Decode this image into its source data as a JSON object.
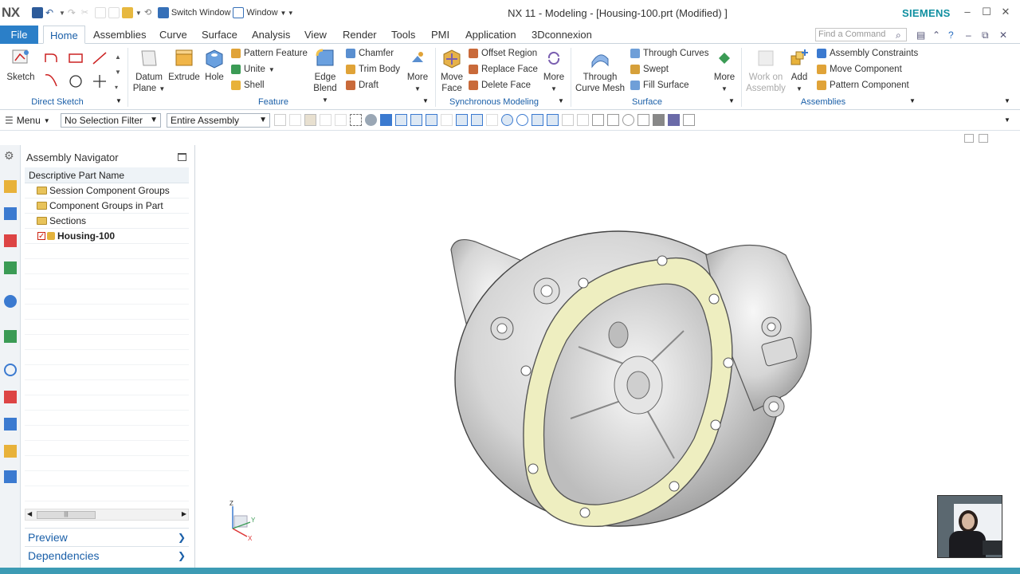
{
  "titlebar": {
    "logo": "NX",
    "switch_window": "Switch Window",
    "window_menu": "Window",
    "title": "NX 11 - Modeling - [Housing-100.prt (Modified) ]",
    "brand": "SIEMENS"
  },
  "tabs": {
    "file": "File",
    "items": [
      "Home",
      "Assemblies",
      "Curve",
      "Surface",
      "Analysis",
      "View",
      "Render",
      "Tools",
      "PMI",
      "Application",
      "3Dconnexion"
    ],
    "find_placeholder": "Find a Command"
  },
  "ribbon": {
    "direct_sketch": {
      "label": "Direct Sketch",
      "sketch": "Sketch"
    },
    "feature": {
      "label": "Feature",
      "datum_plane": [
        "Datum",
        "Plane"
      ],
      "extrude": "Extrude",
      "hole": "Hole",
      "pattern_feature": "Pattern Feature",
      "unite": "Unite",
      "shell": "Shell",
      "edge_blend": [
        "Edge",
        "Blend"
      ],
      "chamfer": "Chamfer",
      "trim_body": "Trim Body",
      "draft": "Draft",
      "more": "More"
    },
    "sync": {
      "label": "Synchronous Modeling",
      "move_face": [
        "Move",
        "Face"
      ],
      "offset_region": "Offset Region",
      "replace_face": "Replace Face",
      "delete_face": "Delete Face",
      "more": "More"
    },
    "surface": {
      "label": "Surface",
      "through_curve_mesh": [
        "Through",
        "Curve Mesh"
      ],
      "through_curves": "Through Curves",
      "swept": "Swept",
      "fill_surface": "Fill Surface",
      "more": "More"
    },
    "assemblies": {
      "label": "Assemblies",
      "work_on": [
        "Work on",
        "Assembly"
      ],
      "add": "Add",
      "constraints": "Assembly Constraints",
      "move_component": "Move Component",
      "pattern_component": "Pattern Component"
    }
  },
  "cmdbar": {
    "menu": "Menu",
    "selection_filter": "No Selection Filter",
    "scope": "Entire Assembly"
  },
  "navigator": {
    "title": "Assembly Navigator",
    "column": "Descriptive Part Name",
    "items": [
      {
        "label": "Session Component Groups"
      },
      {
        "label": "Component Groups in Part"
      },
      {
        "label": "Sections"
      },
      {
        "label": "Housing-100"
      }
    ],
    "preview": "Preview",
    "dependencies": "Dependencies"
  },
  "triad": {
    "z": "Z",
    "x": "X",
    "y": "Y"
  }
}
